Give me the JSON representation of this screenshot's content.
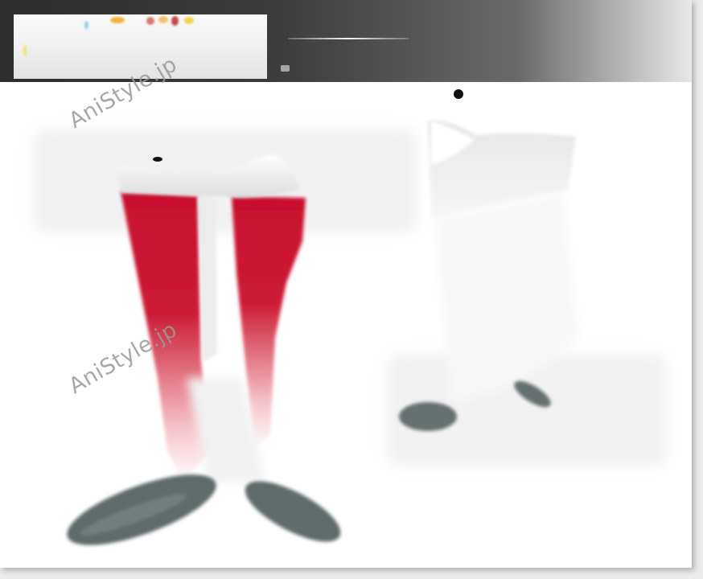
{
  "watermarks": [
    "AniStyle.jp",
    "AniStyle.jp"
  ],
  "colors": {
    "sock_red": "#c8102e",
    "sock_white": "#f4f4f4",
    "sole_grey": "#5f6a6a",
    "top_band": "#3a3a3a",
    "frame_background": "#ffffff"
  }
}
